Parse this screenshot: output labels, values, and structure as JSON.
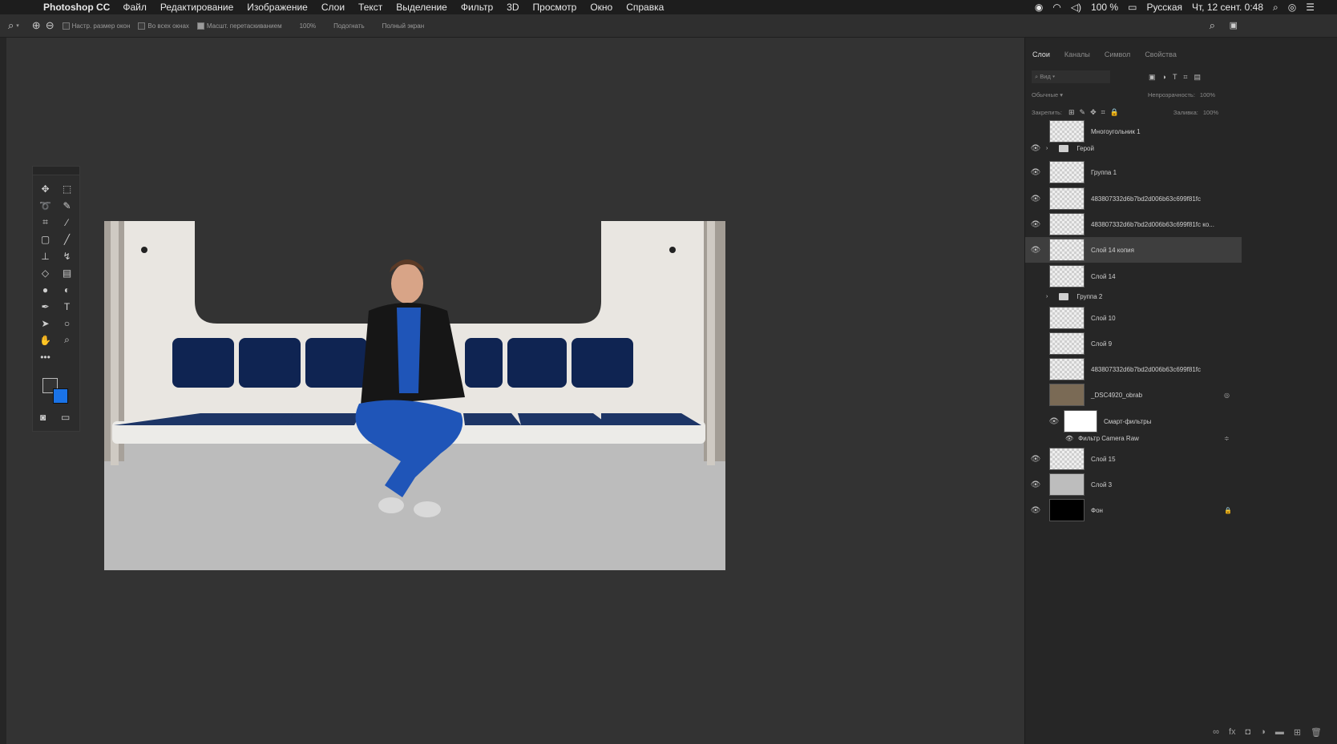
{
  "menubar": {
    "app": "Photoshop CC",
    "items": [
      "Файл",
      "Редактирование",
      "Изображение",
      "Слои",
      "Текст",
      "Выделение",
      "Фильтр",
      "3D",
      "Просмотр",
      "Окно",
      "Справка"
    ],
    "battery": "100 %",
    "input_lang": "Русская",
    "datetime": "Чт, 12 сент. 0:48"
  },
  "options": {
    "resize_windows": "Настр. размер окон",
    "all_windows": "Во всех окнах",
    "scrubby_zoom": "Масшт. перетаскиванием",
    "zoom_100": "100%",
    "fit": "Подогнать",
    "fill_screen": "Полный экран"
  },
  "panel": {
    "tabs": [
      "Слои",
      "Каналы",
      "Символ",
      "Свойства"
    ],
    "kind_filter": "Вид",
    "blend_mode": "Обычные",
    "opacity_label": "Непрозрачность:",
    "opacity_value": "100%",
    "lock_label": "Закрепить:",
    "fill_label": "Заливка:",
    "fill_value": "100%",
    "layers": [
      {
        "name": "Многоугольник 1"
      },
      {
        "name": "Герой"
      },
      {
        "name": "Группа 1"
      },
      {
        "name": "483807332d6b7bd2d006b63c699f81fc"
      },
      {
        "name": "483807332d6b7bd2d006b63c699f81fc ко..."
      },
      {
        "name": "Слой 14 копия"
      },
      {
        "name": "Слой 14"
      },
      {
        "name": "Группа 2"
      },
      {
        "name": "Слой 10"
      },
      {
        "name": "Слой 9"
      },
      {
        "name": "483807332d6b7bd2d006b63c699f81fc"
      },
      {
        "name": "_DSC4920_obrab"
      },
      {
        "name": "Смарт-фильтры"
      },
      {
        "name": "Фильтр Camera Raw"
      },
      {
        "name": "Слой 15"
      },
      {
        "name": "Слой 3"
      },
      {
        "name": "Фон"
      }
    ]
  },
  "colors": {
    "foreground": "#333333",
    "background": "#1a73e8"
  }
}
